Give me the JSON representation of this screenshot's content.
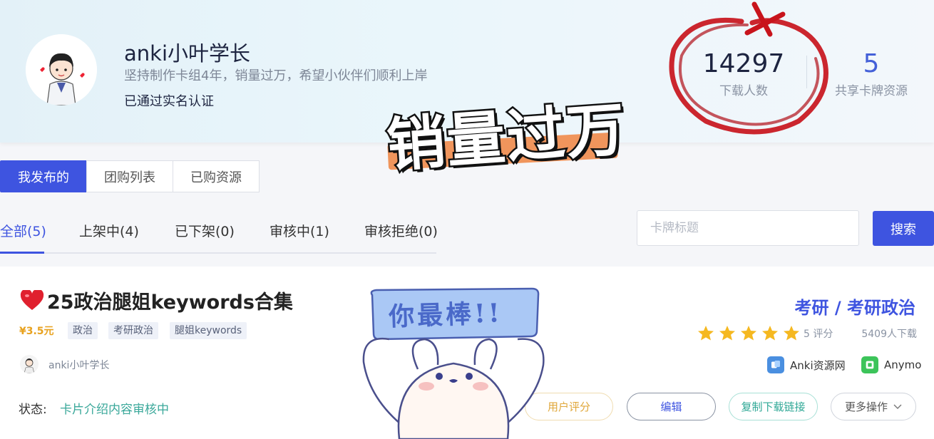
{
  "profile": {
    "name": "anki小叶学长",
    "bio": "坚持制作卡组4年，销量过万，希望小伙伴们顺利上岸",
    "verified": "已通过实名认证"
  },
  "stats": {
    "downloads_value": "14297",
    "downloads_label": "下载人数",
    "shared_value": "5",
    "shared_label": "共享卡牌资源"
  },
  "sticker": {
    "headline": "销量过万",
    "bunny_sign": "你最棒!!"
  },
  "tabs": [
    {
      "label": "我发布的",
      "active": true
    },
    {
      "label": "团购列表",
      "active": false
    },
    {
      "label": "已购资源",
      "active": false
    }
  ],
  "filters": [
    {
      "label": "全部(5)",
      "active": true
    },
    {
      "label": "上架中(4)",
      "active": false
    },
    {
      "label": "已下架(0)",
      "active": false
    },
    {
      "label": "审核中(1)",
      "active": false
    },
    {
      "label": "审核拒绝(0)",
      "active": false
    }
  ],
  "search": {
    "placeholder": "卡牌标题",
    "value": "",
    "button_label": "搜索"
  },
  "card": {
    "title": "25政治腿姐keywords合集",
    "price": "¥3.5元",
    "tags": [
      "政治",
      "考研政治",
      "腿姐keywords"
    ],
    "author": "anki小叶学长",
    "status_label": "状态:",
    "status_value": "卡片介绍内容审核中",
    "category": "考研 / 考研政治",
    "stars": 5,
    "rating": "5 评分",
    "downloads": "5409人下载",
    "platforms": [
      "Anki资源网",
      "Anymo"
    ],
    "actions": {
      "rate": "用户评分",
      "edit": "编辑",
      "copy": "复制下载链接",
      "more": "更多操作"
    }
  },
  "colors": {
    "accent": "#3e54e0",
    "status": "#3aa89a",
    "price": "#e8a21f",
    "annotation_red": "#c8141c"
  }
}
